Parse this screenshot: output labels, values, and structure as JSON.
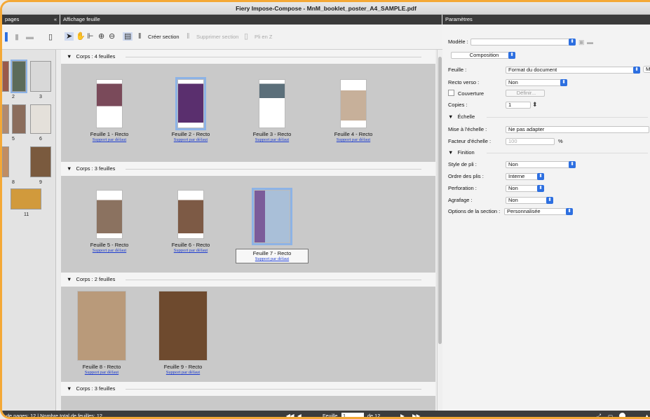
{
  "window": {
    "title": "Fiery Impose-Compose - MnM_booklet_poster_A4_SAMPLE.pdf"
  },
  "pages_panel": {
    "header": "pages",
    "collapse": "«",
    "numbers": [
      "2",
      "3",
      "5",
      "6",
      "8",
      "9",
      "11"
    ]
  },
  "main_panel": {
    "header": "Affichage feuille"
  },
  "toolbar": {
    "create_section": "Créer section",
    "delete_section": "Supprimer section",
    "fold_z": "Pli en Z"
  },
  "sections": [
    {
      "title": "Corps : 4 feuilles",
      "sheets": [
        {
          "label": "Feuille 1 - Recto",
          "media": "Support par défaut"
        },
        {
          "label": "Feuille 2 - Recto",
          "media": "Support par défaut"
        },
        {
          "label": "Feuille 3 - Recto",
          "media": "Support par défaut"
        },
        {
          "label": "Feuille 4 - Recto",
          "media": "Support par défaut"
        }
      ]
    },
    {
      "title": "Corps : 3 feuilles",
      "sheets": [
        {
          "label": "Feuille 5 - Recto",
          "media": "Support par défaut"
        },
        {
          "label": "Feuille 6 - Recto",
          "media": "Support par défaut"
        },
        {
          "label": "Feuille 7 - Recto",
          "media": "Support par défaut"
        }
      ]
    },
    {
      "title": "Corps : 2 feuilles",
      "sheets": [
        {
          "label": "Feuille 8 - Recto",
          "media": "Support par défaut"
        },
        {
          "label": "Feuille 9 - Recto",
          "media": "Support par défaut"
        }
      ]
    },
    {
      "title": "Corps : 3 feuilles",
      "sheets": []
    }
  ],
  "params": {
    "header": "Paramètres",
    "model_label": "Modèle :",
    "model_value": "",
    "composition": "Composition",
    "feuille_label": "Feuille :",
    "feuille_value": "Format du document",
    "feuille_btn": "M",
    "recto_label": "Recto verso :",
    "recto_value": "Non",
    "cover_label": "Couverture",
    "cover_btn": "Définir...",
    "copies_label": "Copies :",
    "copies_value": "1",
    "scale_header": "Échelle",
    "scale_fit_label": "Mise à l'échelle :",
    "scale_fit_value": "Ne pas adapter",
    "scale_factor_label": "Facteur d'échelle :",
    "scale_factor_value": "100",
    "scale_unit": "%",
    "finish_header": "Finition",
    "fold_label": "Style de pli :",
    "fold_value": "Non",
    "order_label": "Ordre des plis :",
    "order_value": "Interne",
    "perf_label": "Perforation :",
    "perf_value": "Non",
    "staple_label": "Agrafage :",
    "staple_value": "Non",
    "opts_label": "Options de la section :",
    "opts_value": "Personnalisée"
  },
  "status": {
    "left": "de pages: 12 | Nombre total de feuilles: 12",
    "sheet_label": "Feuille",
    "sheet_value": "1",
    "of": "de 12"
  }
}
